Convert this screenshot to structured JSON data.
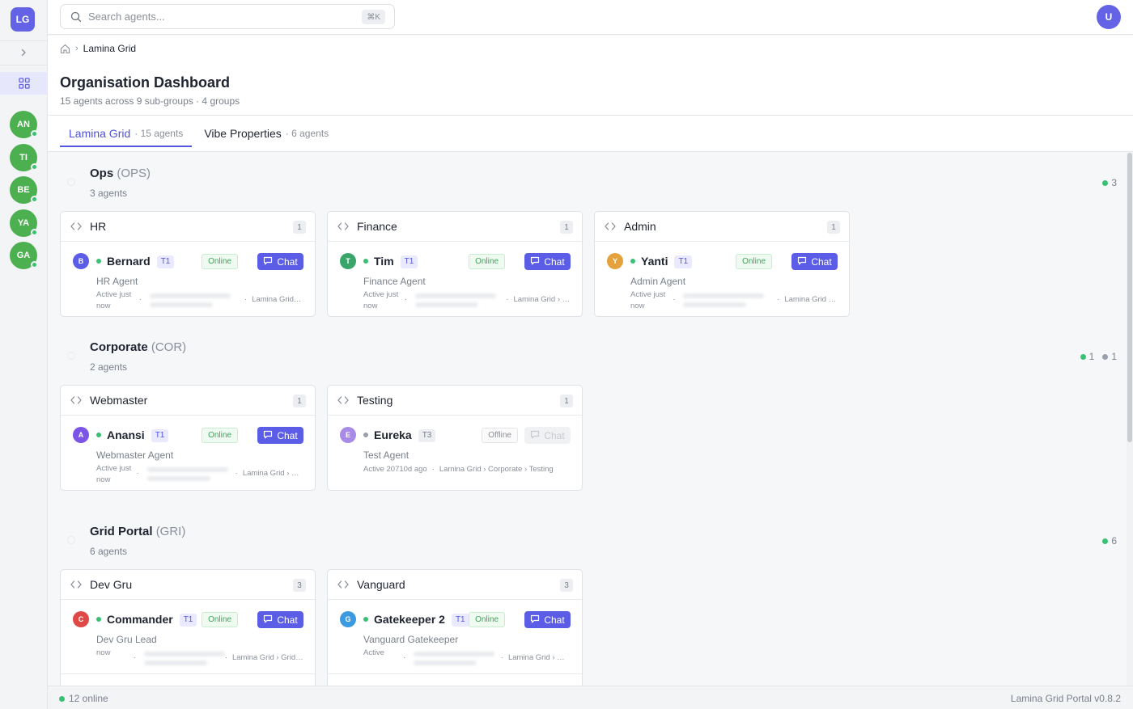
{
  "app": {
    "logo": "LG",
    "user_initial": "U"
  },
  "sidebar": {
    "avatars": [
      {
        "initials": "AN",
        "status": "online"
      },
      {
        "initials": "TI",
        "status": "online"
      },
      {
        "initials": "BE",
        "status": "online"
      },
      {
        "initials": "YA",
        "status": "online"
      },
      {
        "initials": "GA",
        "status": "online"
      }
    ]
  },
  "search": {
    "placeholder": "Search agents...",
    "shortcut": "⌘K"
  },
  "breadcrumb": {
    "current": "Lamina Grid"
  },
  "page": {
    "title": "Organisation Dashboard",
    "subtitle": "15 agents across 9 sub-groups · 4 groups"
  },
  "tabs": [
    {
      "label": "Lamina Grid",
      "count": "· 15 agents",
      "active": true
    },
    {
      "label": "Vibe Properties",
      "count": "· 6 agents",
      "active": false
    }
  ],
  "groups": [
    {
      "name": "Ops",
      "code": "(OPS)",
      "count": "3 agents",
      "stats": [
        {
          "color": "#38c172",
          "value": "3"
        }
      ],
      "cards": [
        {
          "title": "HR",
          "badge": "1",
          "agent": {
            "initial": "B",
            "color": "#5b5de6",
            "name": "Bernard",
            "tier": "T1",
            "online": true,
            "status": "Online",
            "chat": "Chat",
            "role": "HR Agent",
            "active": "Active just now",
            "path": "Lamina Grid ›..."
          }
        },
        {
          "title": "Finance",
          "badge": "1",
          "agent": {
            "initial": "T",
            "color": "#3aa56b",
            "name": "Tim",
            "tier": "T1",
            "online": true,
            "status": "Online",
            "chat": "Chat",
            "role": "Finance Agent",
            "active": "Active just now",
            "path": "Lamina Grid › O..."
          }
        },
        {
          "title": "Admin",
          "badge": "1",
          "agent": {
            "initial": "Y",
            "color": "#e5a23a",
            "name": "Yanti",
            "tier": "T1",
            "online": true,
            "status": "Online",
            "chat": "Chat",
            "role": "Admin Agent",
            "active": "Active just now",
            "path": "Lamina Grid › ..."
          }
        }
      ]
    },
    {
      "name": "Corporate",
      "code": "(COR)",
      "count": "2 agents",
      "stats": [
        {
          "color": "#38c172",
          "value": "1"
        },
        {
          "color": "#9aa0aa",
          "value": "1"
        }
      ],
      "cards": [
        {
          "title": "Webmaster",
          "badge": "1",
          "agent": {
            "initial": "A",
            "color": "#7d55e6",
            "name": "Anansi",
            "tier": "T1",
            "online": true,
            "status": "Online",
            "chat": "Chat",
            "role": "Webmaster Agent",
            "active": "Active just now",
            "path": "Lamina Grid › Cor..."
          }
        },
        {
          "title": "Testing",
          "badge": "1",
          "agent": {
            "initial": "E",
            "color": "#a78be6",
            "name": "Eureka",
            "tier": "T3",
            "online": false,
            "status": "Offline",
            "chat": "Chat",
            "role": "Test Agent",
            "active": "Active 20710d ago",
            "path": "Lamina Grid › Corporate › Testing"
          }
        }
      ]
    },
    {
      "name": "Grid Portal",
      "code": "(GRI)",
      "count": "6 agents",
      "stats": [
        {
          "color": "#38c172",
          "value": "6"
        }
      ],
      "cards": [
        {
          "title": "Dev Gru",
          "badge": "3",
          "agent": {
            "initial": "C",
            "color": "#e04848",
            "name": "Commander",
            "tier": "T1",
            "online": true,
            "status": "Online",
            "chat": "Chat",
            "role": "Dev Gru Lead",
            "active": "now",
            "path": "Lamina Grid › Grid Port..."
          }
        },
        {
          "title": "Vanguard",
          "badge": "3",
          "agent": {
            "initial": "G",
            "color": "#3b9ae0",
            "name": "Gatekeeper 2",
            "tier": "T1",
            "online": true,
            "status": "Online",
            "chat": "Chat",
            "role": "Vanguard Gatekeeper",
            "active": "Active",
            "path": "Lamina Grid › Grid..."
          }
        }
      ]
    }
  ],
  "footer": {
    "online": "12 online",
    "version": "Lamina Grid Portal v0.8.2"
  }
}
